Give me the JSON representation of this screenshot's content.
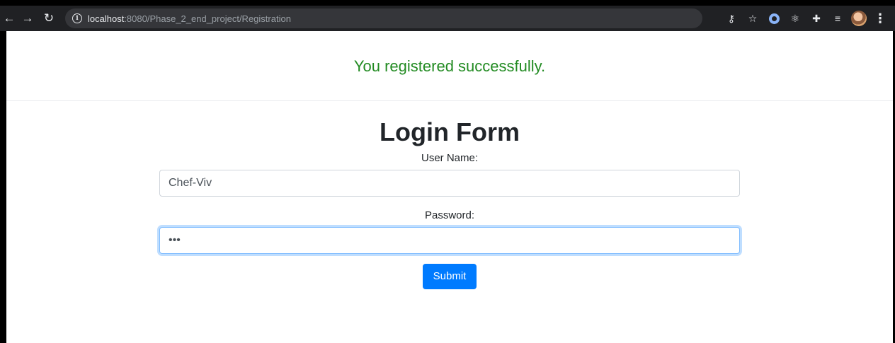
{
  "browser": {
    "url_host": "localhost",
    "url_rest": ":8080/Phase_2_end_project/Registration"
  },
  "page": {
    "success_message": "You registered successfully.",
    "form_title": "Login Form",
    "username_label": "User Name:",
    "username_value": "Chef-Viv",
    "password_label": "Password:",
    "password_value": "•••",
    "submit_label": "Submit"
  },
  "colors": {
    "success": "#228b22",
    "primary": "#007bff",
    "chrome_bg": "#202124"
  },
  "icons": [
    "back-icon",
    "forward-icon",
    "reload-icon",
    "info-icon",
    "key-icon",
    "star-icon",
    "extension-ring-icon",
    "react-icon",
    "puzzle-icon",
    "playlist-icon",
    "profile-avatar",
    "menu-kebab-icon"
  ]
}
